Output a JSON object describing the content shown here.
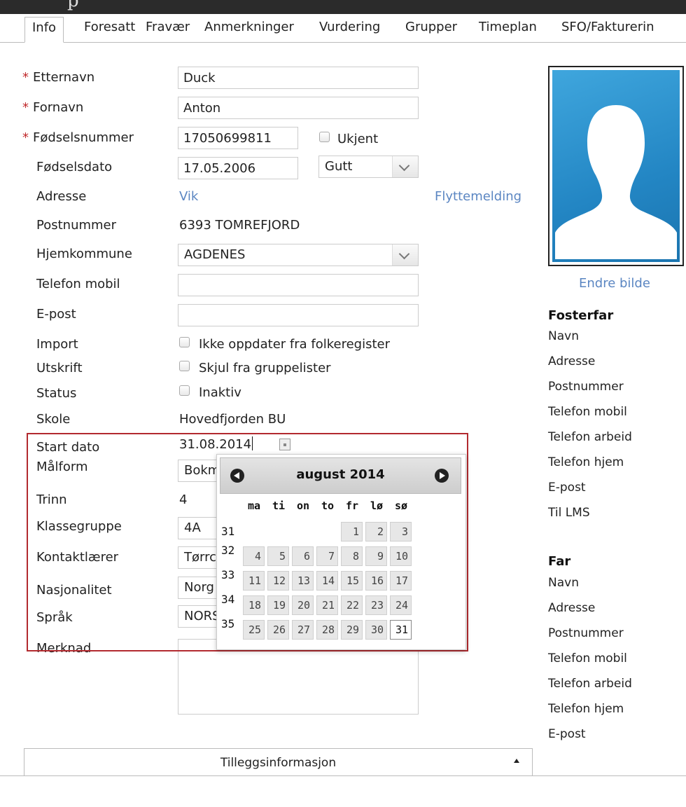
{
  "top_bar": {
    "text": "p"
  },
  "tabs": [
    "Info",
    "Foresatt",
    "Fravær",
    "Anmerkninger",
    "Vurdering",
    "Grupper",
    "Timeplan",
    "SFO/Fakturerin"
  ],
  "form": {
    "etternavn": {
      "label": "Etternavn",
      "value": "Duck",
      "required": "*"
    },
    "fornavn": {
      "label": "Fornavn",
      "value": "Anton",
      "required": "*"
    },
    "fodselsnummer": {
      "label": "Fødselsnummer",
      "value": "17050699811",
      "required": "*",
      "ukjent_label": "Ukjent"
    },
    "fodselsdato": {
      "label": "Fødselsdato",
      "value": "17.05.2006",
      "gender": "Gutt"
    },
    "adresse": {
      "label": "Adresse",
      "value": "Vik",
      "action": "Flyttemelding"
    },
    "postnummer": {
      "label": "Postnummer",
      "value": "6393 TOMREFJORD"
    },
    "hjemkommune": {
      "label": "Hjemkommune",
      "value": "AGDENES"
    },
    "telefon_mobil": {
      "label": "Telefon mobil",
      "value": ""
    },
    "epost": {
      "label": "E-post",
      "value": ""
    },
    "import": {
      "label": "Import",
      "checkbox": "Ikke oppdater fra folkeregister"
    },
    "utskrift": {
      "label": "Utskrift",
      "checkbox": "Skjul fra gruppelister"
    },
    "status": {
      "label": "Status",
      "checkbox": "Inaktiv"
    },
    "skole": {
      "label": "Skole",
      "value": "Hovedfjorden BU"
    },
    "start_dato": {
      "label": "Start dato",
      "value": "31.08.2014"
    },
    "malform": {
      "label": "Målform",
      "value": "Bokm"
    },
    "trinn": {
      "label": "Trinn",
      "value": "4"
    },
    "klassegruppe": {
      "label": "Klassegruppe",
      "value": "4A"
    },
    "kontaktlaerer": {
      "label": "Kontaktlærer",
      "value": "Tørrc"
    },
    "nasjonalitet": {
      "label": "Nasjonalitet",
      "value": "Norg"
    },
    "sprak": {
      "label": "Språk",
      "value": "NORS"
    },
    "merknad": {
      "label": "Merknad"
    }
  },
  "photo": {
    "change_label": "Endre bilde"
  },
  "right_panel": {
    "fosterfar": {
      "title": "Fosterfar",
      "rows": [
        "Navn",
        "Adresse",
        "Postnummer",
        "Telefon mobil",
        "Telefon arbeid",
        "Telefon hjem",
        "E-post",
        "Til LMS"
      ]
    },
    "far": {
      "title": "Far",
      "rows": [
        "Navn",
        "Adresse",
        "Postnummer",
        "Telefon mobil",
        "Telefon arbeid",
        "Telefon hjem",
        "E-post"
      ]
    }
  },
  "calendar": {
    "title": "august 2014",
    "weekdays": [
      "ma",
      "ti",
      "on",
      "to",
      "fr",
      "lø",
      "sø"
    ],
    "weeks": [
      {
        "week": "31",
        "days": [
          "",
          "",
          "",
          "",
          "1",
          "2",
          "3"
        ]
      },
      {
        "week": "32",
        "days": [
          "4",
          "5",
          "6",
          "7",
          "8",
          "9",
          "10"
        ]
      },
      {
        "week": "33",
        "days": [
          "11",
          "12",
          "13",
          "14",
          "15",
          "16",
          "17"
        ]
      },
      {
        "week": "34",
        "days": [
          "18",
          "19",
          "20",
          "21",
          "22",
          "23",
          "24"
        ]
      },
      {
        "week": "35",
        "days": [
          "25",
          "26",
          "27",
          "28",
          "29",
          "30",
          "31"
        ]
      }
    ],
    "selected_day": "31"
  },
  "accordion": {
    "label": "Tilleggsinformasjon"
  }
}
